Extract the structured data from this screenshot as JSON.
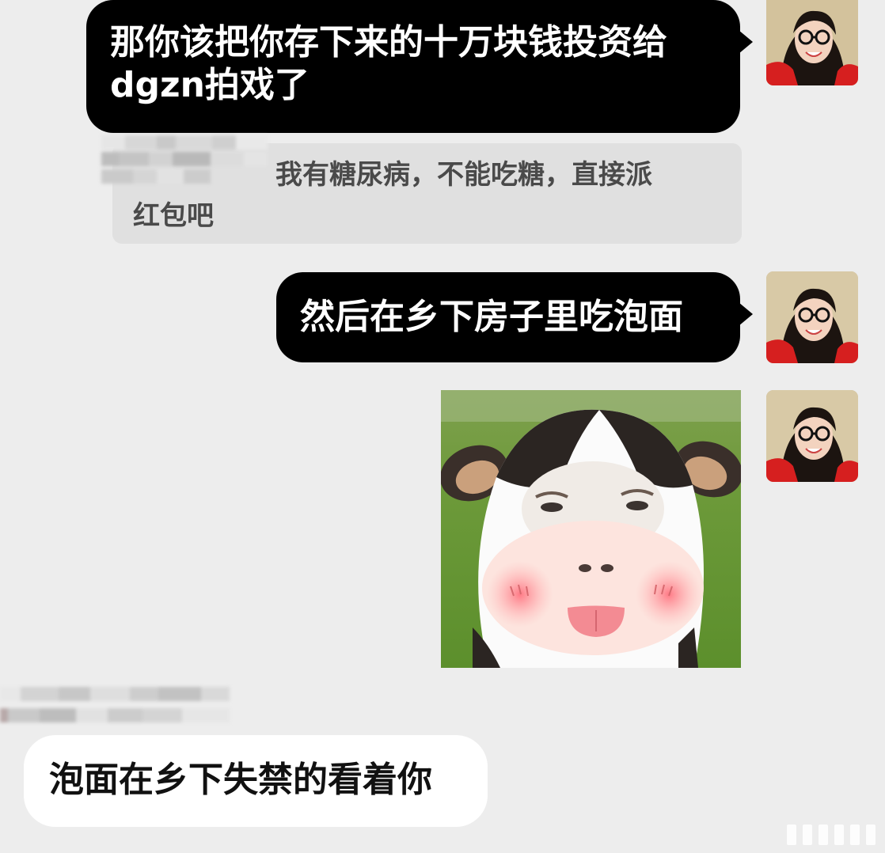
{
  "messages": [
    {
      "id": "m1",
      "side": "outgoing",
      "text_line1": "那你该把你存下来的十万块钱投资给",
      "text_line2": "dgzn拍戏了"
    },
    {
      "id": "q1",
      "kind": "quote",
      "text_line1": "我有糖尿病，不能吃糖，直接派",
      "text_line2": "红包吧"
    },
    {
      "id": "m2",
      "side": "outgoing",
      "text": "然后在乡下房子里吃泡面"
    },
    {
      "id": "m3",
      "side": "outgoing",
      "kind": "sticker",
      "sticker_icon": "cow-face-sticker"
    },
    {
      "id": "m4",
      "side": "incoming",
      "text": "泡面在乡下失禁的看着你"
    }
  ],
  "colors": {
    "background": "#ededed",
    "outgoing_bubble": "#000000",
    "incoming_bubble": "#ffffff",
    "quote_bg": "#e0e0e0"
  }
}
